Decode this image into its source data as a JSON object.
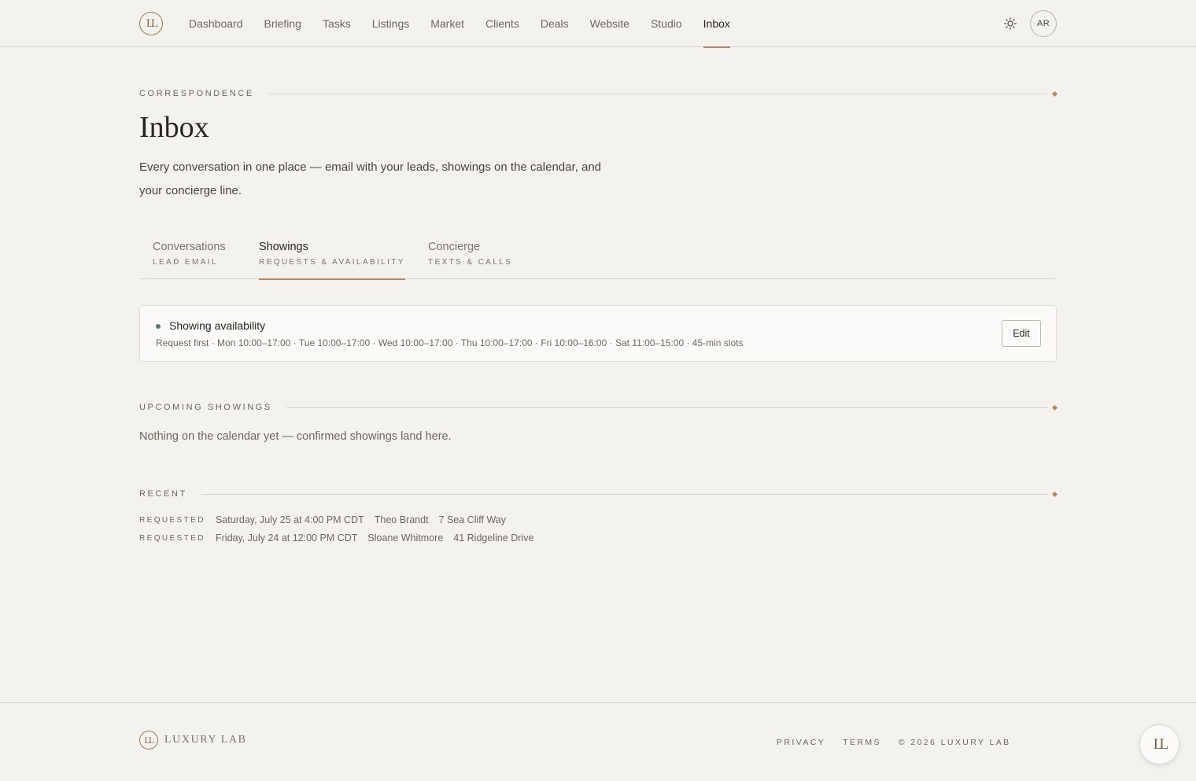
{
  "brand": {
    "monogram": "LL",
    "wordmark": "LUXURY LAB",
    "accent_color": "#b28a67"
  },
  "nav": {
    "items": [
      {
        "label": "Dashboard"
      },
      {
        "label": "Briefing"
      },
      {
        "label": "Tasks"
      },
      {
        "label": "Listings"
      },
      {
        "label": "Market"
      },
      {
        "label": "Clients"
      },
      {
        "label": "Deals"
      },
      {
        "label": "Website"
      },
      {
        "label": "Studio"
      },
      {
        "label": "Inbox",
        "active": true
      }
    ],
    "theme_icon": "sun-icon",
    "avatar_initials": "AR"
  },
  "header": {
    "eyebrow": "CORRESPONDENCE",
    "title": "Inbox",
    "description": "Every conversation in one place — email with your leads, showings on the calendar, and your concierge line."
  },
  "tabs": [
    {
      "label": "Conversations",
      "sublabel": "LEAD EMAIL"
    },
    {
      "label": "Showings",
      "sublabel": "REQUESTS & AVAILABILITY",
      "active": true
    },
    {
      "label": "Concierge",
      "sublabel": "TEXTS & CALLS"
    }
  ],
  "availability": {
    "title": "Showing availability",
    "status_color": "#5e7a64",
    "schedule": "Request first · Mon 10:00–17:00 · Tue 10:00–17:00 · Wed 10:00–17:00 · Thu 10:00–17:00 · Fri 10:00–16:00 · Sat 11:00–15:00 · 45-min slots",
    "edit_label": "Edit"
  },
  "upcoming": {
    "heading": "UPCOMING SHOWINGS",
    "empty_text": "Nothing on the calendar yet — confirmed showings land here."
  },
  "recent": {
    "heading": "RECENT",
    "rows": [
      {
        "status": "REQUESTED",
        "when": "Saturday, July 25 at 4:00 PM CDT",
        "who": "Theo Brandt",
        "where": "7 Sea Cliff Way"
      },
      {
        "status": "REQUESTED",
        "when": "Friday, July 24 at 12:00 PM CDT",
        "who": "Sloane Whitmore",
        "where": "41 Ridgeline Drive"
      }
    ]
  },
  "footer": {
    "privacy": "PRIVACY",
    "terms": "TERMS",
    "copyright": "© 2026 LUXURY LAB"
  }
}
